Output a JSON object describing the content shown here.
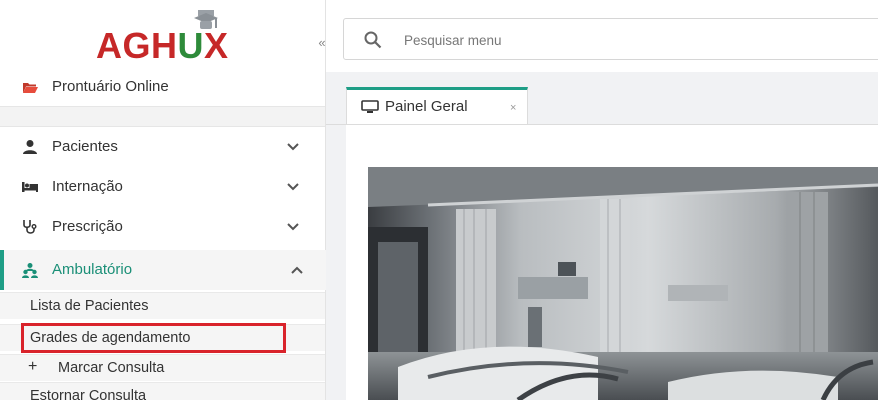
{
  "logo": {
    "part1": "AGH",
    "part2": "U",
    "part3": "X"
  },
  "sidebar": {
    "collapse_glyph": "«",
    "items": [
      {
        "label": "Prontuário Online",
        "icon": "folder-open-icon"
      },
      {
        "label": "Pacientes",
        "icon": "user-icon"
      },
      {
        "label": "Internação",
        "icon": "bed-icon"
      },
      {
        "label": "Prescrição",
        "icon": "stethoscope-icon"
      },
      {
        "label": "Ambulatório",
        "icon": "users-icon"
      }
    ],
    "subitems": [
      {
        "label": "Lista de Pacientes"
      },
      {
        "label": "Grades de agendamento"
      },
      {
        "label": "Marcar Consulta",
        "prefix": "+"
      },
      {
        "label": "Estornar Consulta"
      }
    ]
  },
  "search": {
    "placeholder": "Pesquisar menu"
  },
  "tabs": [
    {
      "label": "Painel Geral",
      "close": "×"
    }
  ],
  "colors": {
    "accent": "#1e9e86",
    "logo_red": "#c62828",
    "logo_green": "#2e8b3a",
    "highlight": "#d9232b"
  }
}
